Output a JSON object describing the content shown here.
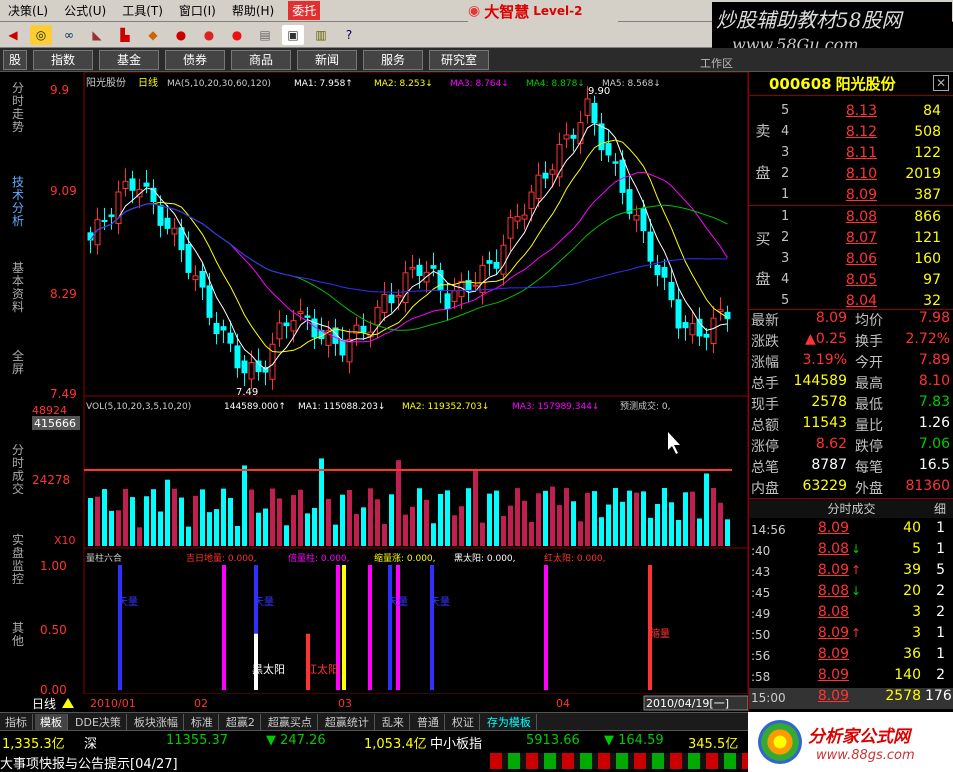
{
  "menu": [
    "决策(L)",
    "公式(U)",
    "工具(T)",
    "窗口(I)",
    "帮助(H)"
  ],
  "menu_alert": "委托",
  "brand": {
    "logo": "大智慧",
    "edition": "Level-2"
  },
  "watermark_top": {
    "line1": "炒股辅助教材58股网",
    "line2": "www.58Gu.com"
  },
  "nav_buttons": [
    "股",
    "指数",
    "基金",
    "债券",
    "商品",
    "新闻",
    "服务",
    "研究室"
  ],
  "work_label": "工作区",
  "side_tabs": [
    "分时走势",
    "技术分析",
    "基本资料",
    "全屏",
    "分时成交",
    "实盘监控",
    "其他"
  ],
  "chart_header": {
    "name": "阳光股份",
    "period": "日线",
    "ma_params": "MA(5,10,20,30,60,120)",
    "ma1": "MA1: 7.958↑",
    "ma2": "MA2: 8.253↓",
    "ma3": "MA3: 8.764↓",
    "ma4": "MA4: 8.878↓",
    "ma5": "MA5: 8.568↓"
  },
  "price_labels": [
    "9.9",
    "9.09",
    "8.29",
    "7.49"
  ],
  "annotation_low": "7.49",
  "annotation_high": "9.90",
  "vol_header": {
    "params": "VOL(5,10,20,3,5,10,20)",
    "vol": "144589.000↑",
    "ma1": "MA1: 115088.203↓",
    "ma2": "MA2: 119352.703↓",
    "ma3": "MA3: 157989.344↓",
    "forecast": "预测成交: 0,"
  },
  "vol_labels": [
    "48924",
    "415666",
    "24278",
    "X10"
  ],
  "ind_header": {
    "name": "量柱六合",
    "a": "吉日地量: 0.000,",
    "b": "倍量柱: 0.000,",
    "c": "缩量涨: 0.000,",
    "d": "黑太阳: 0.000,",
    "e": "红太阳: 0.000,"
  },
  "ind_labels": [
    "1.00",
    "0.50",
    "0.00"
  ],
  "ind_annotations": [
    "天量",
    "天量",
    "天量",
    "天量",
    "黑太阳",
    "红太阳",
    "缩量"
  ],
  "date_labels": [
    "2010/01",
    "02",
    "03",
    "04"
  ],
  "date_box": "2010/04/19[一]",
  "period_label": "日线",
  "stock": {
    "code": "000608",
    "name": "阳光股份"
  },
  "sell_label": [
    "卖",
    "盘"
  ],
  "buy_label": [
    "买",
    "盘"
  ],
  "sell": [
    {
      "idx": "5",
      "price": "8.13",
      "vol": "84"
    },
    {
      "idx": "4",
      "price": "8.12",
      "vol": "508"
    },
    {
      "idx": "3",
      "price": "8.11",
      "vol": "122"
    },
    {
      "idx": "2",
      "price": "8.10",
      "vol": "2019"
    },
    {
      "idx": "1",
      "price": "8.09",
      "vol": "387"
    }
  ],
  "buy": [
    {
      "idx": "1",
      "price": "8.08",
      "vol": "866"
    },
    {
      "idx": "2",
      "price": "8.07",
      "vol": "121"
    },
    {
      "idx": "3",
      "price": "8.06",
      "vol": "160"
    },
    {
      "idx": "4",
      "price": "8.05",
      "vol": "97"
    },
    {
      "idx": "5",
      "price": "8.04",
      "vol": "32"
    }
  ],
  "quote": [
    {
      "l1": "最新",
      "v1": "8.09",
      "l2": "均价",
      "v2": "7.98"
    },
    {
      "l1": "涨跌",
      "v1": "▲0.25",
      "l2": "换手",
      "v2": "2.72%"
    },
    {
      "l1": "涨幅",
      "v1": "3.19%",
      "l2": "今开",
      "v2": "7.89"
    },
    {
      "l1": "总手",
      "v1": "144589",
      "l2": "最高",
      "v2": "8.10"
    },
    {
      "l1": "现手",
      "v1": "2578",
      "l2": "最低",
      "v2": "7.83"
    },
    {
      "l1": "总额",
      "v1": "11543",
      "l2": "量比",
      "v2": "1.26"
    },
    {
      "l1": "涨停",
      "v1": "8.62",
      "l2": "跌停",
      "v2": "7.06"
    },
    {
      "l1": "总笔",
      "v1": "8787",
      "l2": "每笔",
      "v2": "16.5"
    },
    {
      "l1": "内盘",
      "v1": "63229",
      "l2": "外盘",
      "v2": "81360"
    }
  ],
  "ticks_title": "分时成交",
  "ticks_detail": "细",
  "ticks": [
    {
      "time": "14:56",
      "price": "8.09",
      "arrow": "",
      "vol": "40",
      "n": "1"
    },
    {
      "time": ":40",
      "price": "8.08",
      "arrow": "↓",
      "vol": "5",
      "n": "1"
    },
    {
      "time": ":43",
      "price": "8.09",
      "arrow": "↑",
      "vol": "39",
      "n": "5"
    },
    {
      "time": ":45",
      "price": "8.08",
      "arrow": "↓",
      "vol": "20",
      "n": "2"
    },
    {
      "time": ":49",
      "price": "8.08",
      "arrow": "",
      "vol": "3",
      "n": "2"
    },
    {
      "time": ":50",
      "price": "8.09",
      "arrow": "↑",
      "vol": "3",
      "n": "1"
    },
    {
      "time": ":56",
      "price": "8.09",
      "arrow": "",
      "vol": "36",
      "n": "1"
    },
    {
      "time": ":58",
      "price": "8.09",
      "arrow": "",
      "vol": "140",
      "n": "2"
    },
    {
      "time": "15:00",
      "price": "8.09",
      "arrow": "",
      "vol": "2578",
      "n": "176"
    }
  ],
  "bottom_tabs": [
    "指标",
    "模板",
    "DDE决策",
    "板块涨幅",
    "标准",
    "超赢2",
    "超赢买点",
    "超赢统计",
    "乱来",
    "普通",
    "权证",
    "存为模板"
  ],
  "status": {
    "sh": "1,335.3亿",
    "sz_label": "深",
    "sz": "11355.37",
    "sz_chg": "▼ 247.26",
    "sz_amt": "1,053.4亿",
    "small_label": "中小板指",
    "small": "5913.66",
    "small_chg": "▼ 164.59",
    "small_amt": "345.5亿",
    "notice": "大事项快报与公告提示[04/27]"
  },
  "watermark_bottom": {
    "line1": "分析家公式网",
    "line2": "www.88gs.com"
  },
  "colors": {
    "up": "#ff3333",
    "down": "#00ffff",
    "ma5": "#ffffff",
    "ma10": "#ffff00",
    "ma20": "#ff00ff",
    "ma30": "#00c000",
    "ma60": "#3030ff"
  }
}
